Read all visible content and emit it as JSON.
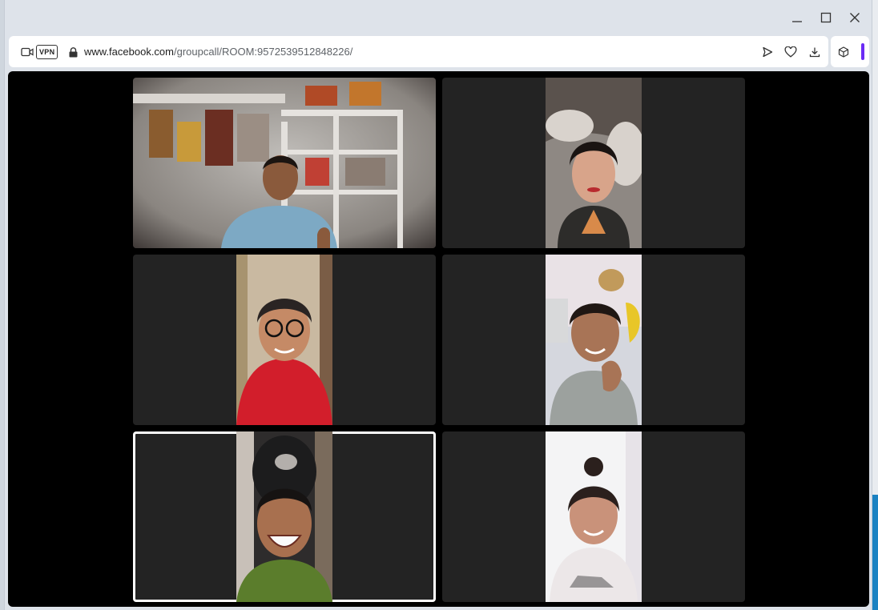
{
  "window": {
    "controls": [
      "minimize",
      "maximize",
      "close"
    ]
  },
  "address_bar": {
    "vpn_label": "VPN",
    "url_host": "www.facebook.com",
    "url_path": "/groupcall/ROOM:9572539512848226/",
    "icons": [
      "camera-icon",
      "lock-icon",
      "send-icon",
      "heart-icon",
      "download-icon",
      "box-icon"
    ]
  },
  "call": {
    "participants": [
      {
        "tile": "participant-1",
        "speaking": false
      },
      {
        "tile": "participant-2",
        "speaking": false
      },
      {
        "tile": "participant-3",
        "speaking": false
      },
      {
        "tile": "participant-4",
        "speaking": false
      },
      {
        "tile": "participant-5",
        "speaking": true
      },
      {
        "tile": "participant-6",
        "speaking": false
      }
    ]
  },
  "colors": {
    "call_background": "#000000",
    "tile_background": "#232323",
    "active_speaker_border": "#ffffff",
    "extension_accent": "#6b2cf5"
  }
}
